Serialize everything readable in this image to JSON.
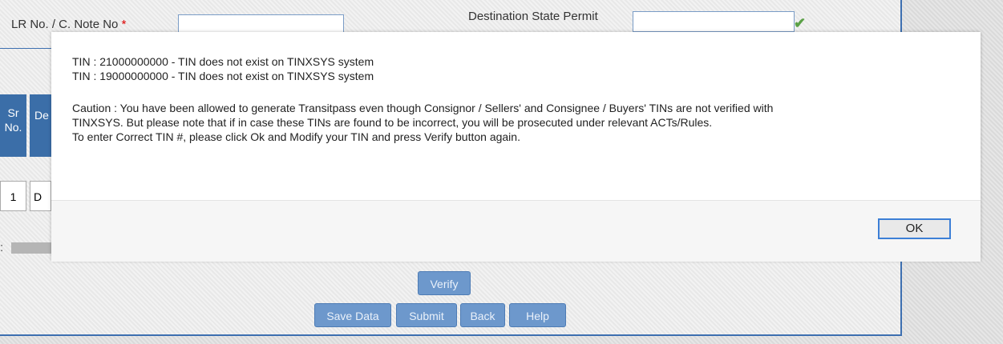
{
  "form": {
    "lr_label": "LR No. / C. Note No",
    "required_mark": "*",
    "dest_label": "Destination State Permit",
    "table": {
      "col_sr": "Sr No.",
      "col_de": "De",
      "row_sr": "1",
      "row_de": "D"
    },
    "colon": ":",
    "buttons": {
      "verify": "Verify",
      "save": "Save Data",
      "submit": "Submit",
      "back": "Back",
      "help": "Help"
    }
  },
  "dialog": {
    "line1": "TIN : 21000000000 - TIN does not exist on TINXSYS system",
    "line2": "TIN : 19000000000 - TIN does not exist on TINXSYS system",
    "caution1": "Caution : You have been allowed to generate Transitpass even though Consignor / Sellers' and Consignee / Buyers' TINs are not verified with",
    "caution2": "TINXSYS. But please note that if in case these TINs are found to be incorrect, you will be prosecuted under relevant ACTs/Rules.",
    "caution3": "To enter Correct TIN #, please click Ok and Modify your TIN and press Verify button again.",
    "ok_label": "OK"
  },
  "colors": {
    "accent": "#3b6ea8",
    "button": "#6d98cc",
    "ok_border": "#3c7fd6"
  },
  "icons": {
    "check": "check-icon"
  }
}
